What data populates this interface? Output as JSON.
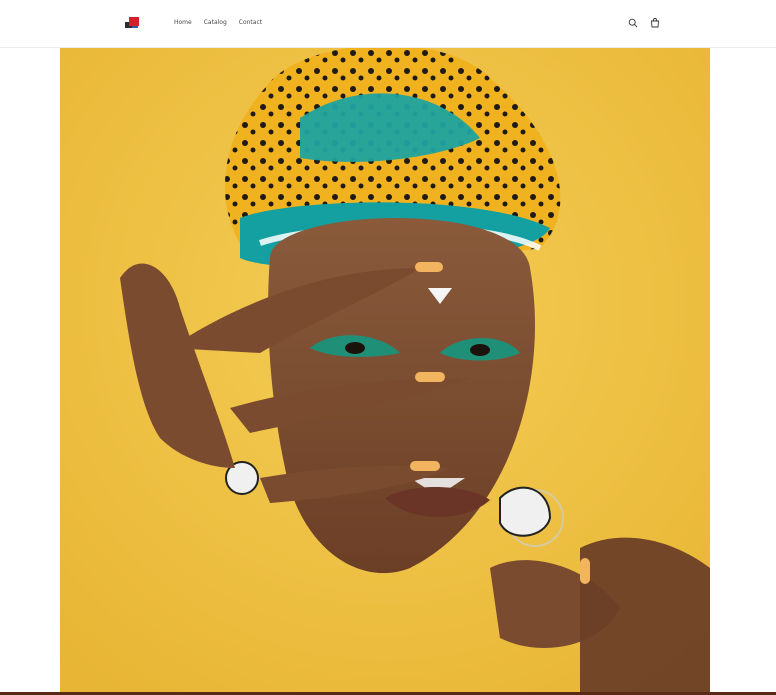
{
  "header": {
    "logo_icon": "brand-logo-icon",
    "nav": [
      {
        "label": "Home"
      },
      {
        "label": "Catalog"
      },
      {
        "label": "Contact"
      }
    ],
    "search_icon": "search-icon",
    "cart_icon": "cart-icon"
  },
  "hero": {
    "image": "portrait-woman-headwrap"
  },
  "colors": {
    "background": "#ffffff",
    "hero_background": "#efc041",
    "nav_text": "#4b4b4b",
    "accent_red": "#d81f27"
  }
}
